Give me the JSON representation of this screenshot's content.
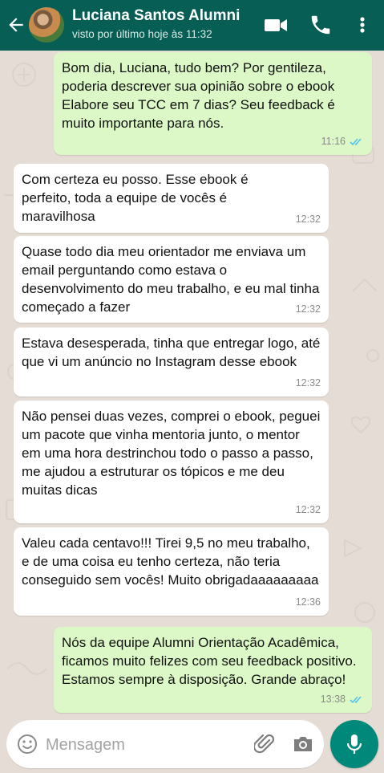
{
  "header": {
    "contact_name": "Luciana Santos Alumni",
    "last_seen": "visto por último hoje às 11:32",
    "icons": [
      "back-arrow-icon",
      "video-call-icon",
      "phone-icon",
      "more-options-icon"
    ]
  },
  "messages": [
    {
      "direction": "outgoing",
      "text": "Bom dia, Luciana, tudo bem? Por gentileza, poderia descrever sua opinião sobre o ebook Elabore seu TCC em 7 dias? Seu feedback é muito importante para nós.",
      "time": "11:16",
      "status": "read"
    },
    {
      "direction": "incoming",
      "text": "Com certeza eu posso. Esse ebook é perfeito, toda a equipe de vocês é maravilhosa",
      "time": "12:32"
    },
    {
      "direction": "incoming",
      "text": "Quase todo dia meu orientador me enviava um email perguntando como estava o desenvolvimento do meu trabalho, e eu mal tinha começado a fazer",
      "time": "12:32"
    },
    {
      "direction": "incoming",
      "text": "Estava desesperada, tinha que entregar logo, até que vi um anúncio no Instagram desse ebook",
      "time": "12:32"
    },
    {
      "direction": "incoming",
      "text": "Não pensei duas vezes, comprei o ebook, peguei um pacote que vinha mentoria junto, o mentor em uma hora destrinchou todo o passo a passo, me ajudou a estruturar os tópicos e me deu muitas dicas",
      "time": "12:32"
    },
    {
      "direction": "incoming",
      "text": "Valeu cada centavo!!! Tirei 9,5 no meu trabalho, e de uma coisa eu tenho certeza, não teria conseguido sem vocês! Muito obrigadaaaaaaaaa",
      "time": "12:36"
    },
    {
      "direction": "outgoing",
      "text": "Nós da equipe Alumni Orientação Acadêmica, ficamos muito felizes com seu feedback positivo. Estamos sempre à disposição. Grande abraço!",
      "time": "13:38",
      "status": "read"
    }
  ],
  "composer": {
    "placeholder": "Mensagem",
    "icons": [
      "emoji-icon",
      "attach-icon",
      "camera-icon",
      "microphone-icon"
    ]
  },
  "colors": {
    "header_bg": "#075e54",
    "chat_bg": "#e5ddd5",
    "outgoing_bubble": "#dcf8c6",
    "incoming_bubble": "#ffffff",
    "read_ticks": "#4fc3f7",
    "mic_button": "#00897b"
  }
}
